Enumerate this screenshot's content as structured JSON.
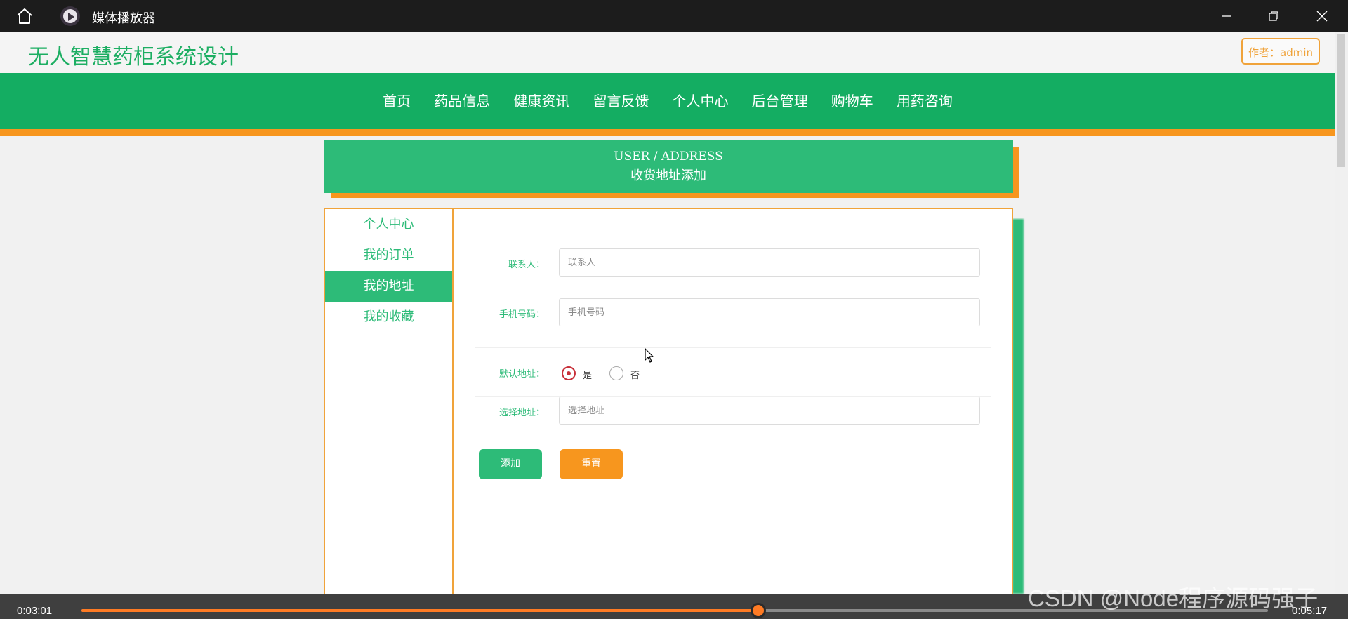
{
  "player": {
    "title": "媒体播放器",
    "current_time": "0:03:01",
    "total_time": "0:05:17",
    "progress": 0.5707,
    "accent_color": "#ff7b24",
    "icons": [
      "home-icon",
      "media-player-icon",
      "minimize-icon",
      "maximize-icon",
      "close-icon"
    ]
  },
  "site": {
    "title": "无人智慧药柜系统设计",
    "author_badge": "作者：admin",
    "nav": [
      "首页",
      "药品信息",
      "健康资讯",
      "留言反馈",
      "个人中心",
      "后台管理",
      "购物车",
      "用药咨询"
    ],
    "colors": {
      "primary": "#14ad62",
      "accent": "#f7961e",
      "panel": "#2dbb78"
    }
  },
  "banner": {
    "en": "USER / ADDRESS",
    "cn": "收货地址添加"
  },
  "sidebar": {
    "items": [
      "个人中心",
      "我的订单",
      "我的地址",
      "我的收藏"
    ],
    "active_index": 2
  },
  "form": {
    "contact": {
      "label": "联系人：",
      "placeholder": "联系人",
      "value": ""
    },
    "phone": {
      "label": "手机号码：",
      "placeholder": "手机号码",
      "value": ""
    },
    "default_address": {
      "label": "默认地址：",
      "options": [
        "是",
        "否"
      ],
      "selected": "是"
    },
    "address": {
      "label": "选择地址：",
      "placeholder": "选择地址",
      "value": ""
    },
    "add_button": "添加",
    "reset_button": "重置"
  },
  "watermark": "CSDN @Node程序源码强子"
}
